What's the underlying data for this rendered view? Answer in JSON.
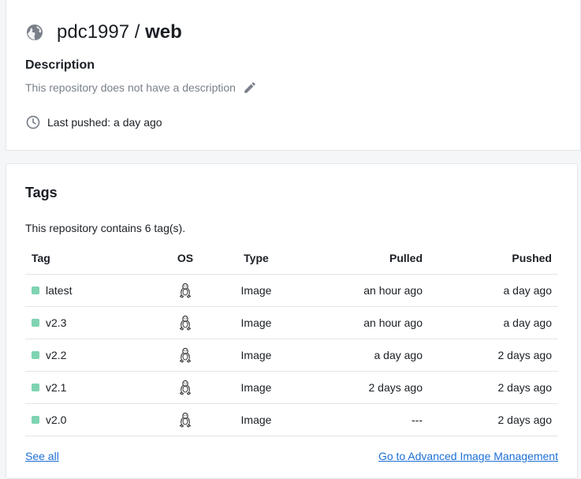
{
  "repo": {
    "namespace": "pdc1997",
    "separator": " / ",
    "name": "web",
    "icon": "globe-icon"
  },
  "description": {
    "heading": "Description",
    "text": "This repository does not have a description",
    "edit_icon": "pencil-icon"
  },
  "last_pushed": {
    "icon": "clock-icon",
    "text": "Last pushed: a day ago"
  },
  "tags": {
    "heading": "Tags",
    "count_text": "This repository contains 6 tag(s).",
    "columns": [
      "Tag",
      "OS",
      "Type",
      "Pulled",
      "Pushed"
    ],
    "rows": [
      {
        "tag": "latest",
        "os_icon": "linux-tux-icon",
        "type": "Image",
        "pulled": "an hour ago",
        "pushed": "a day ago"
      },
      {
        "tag": "v2.3",
        "os_icon": "linux-tux-icon",
        "type": "Image",
        "pulled": "an hour ago",
        "pushed": "a day ago"
      },
      {
        "tag": "v2.2",
        "os_icon": "linux-tux-icon",
        "type": "Image",
        "pulled": "a day ago",
        "pushed": "2 days ago"
      },
      {
        "tag": "v2.1",
        "os_icon": "linux-tux-icon",
        "type": "Image",
        "pulled": "2 days ago",
        "pushed": "2 days ago"
      },
      {
        "tag": "v2.0",
        "os_icon": "linux-tux-icon",
        "type": "Image",
        "pulled": "---",
        "pushed": "2 days ago"
      }
    ],
    "see_all": "See all",
    "advanced_link": "Go to Advanced Image Management"
  },
  "colors": {
    "tag_dot": "#7ed3b2",
    "link": "#1c6fd6",
    "muted_text": "#7a8089"
  }
}
